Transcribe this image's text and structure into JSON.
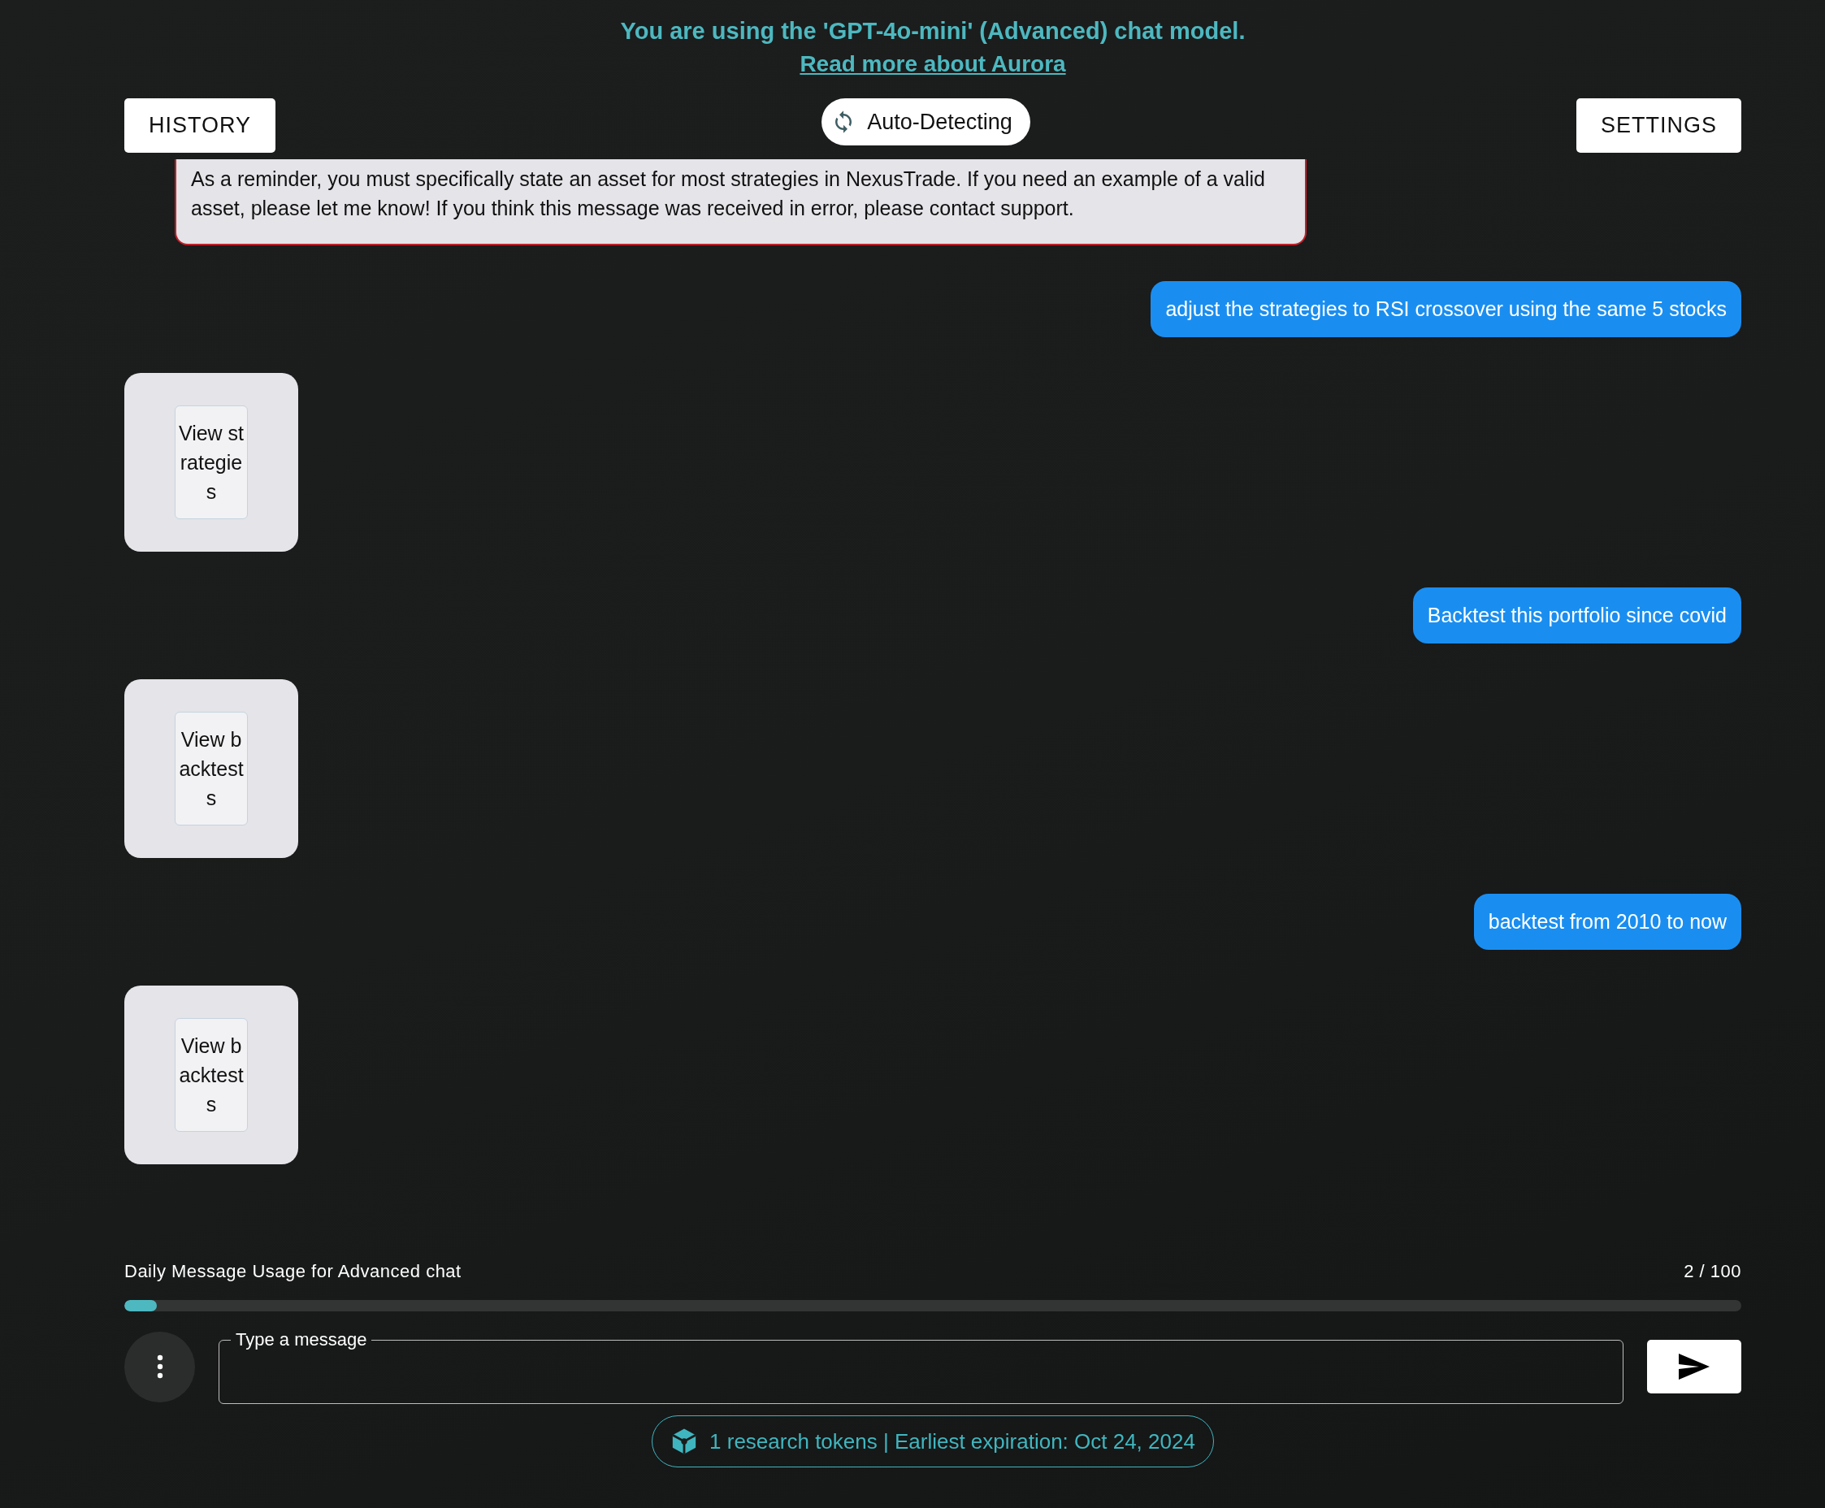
{
  "banner": {
    "model_notice": "You are using the 'GPT-4o-mini' (Advanced) chat model.",
    "link": "Read more about Aurora"
  },
  "toolbar": {
    "history_button": "HISTORY",
    "mode_chip": "Auto-Detecting",
    "settings_button": "SETTINGS"
  },
  "messages": [
    {
      "kind": "error",
      "text": "As a reminder, you must specifically state an asset for most strategies in NexusTrade. If you need an example of a valid asset, please let me know! If you think this message was received in error, please contact support."
    },
    {
      "kind": "user",
      "text": "adjust the strategies to RSI crossover using the same 5 stocks"
    },
    {
      "kind": "action",
      "button": "View strategies"
    },
    {
      "kind": "user",
      "text": "Backtest this portfolio since covid"
    },
    {
      "kind": "action",
      "button": "View backtests"
    },
    {
      "kind": "user",
      "text": "backtest from 2010 to now"
    },
    {
      "kind": "action",
      "button": "View backtests"
    }
  ],
  "usage": {
    "label": "Daily Message Usage for Advanced chat",
    "count": "2 / 100",
    "level": 0.02
  },
  "composer": {
    "placeholder": "Type a message"
  },
  "tokens": {
    "text": "1 research tokens | Earliest expiration: Oct 24, 2024"
  }
}
